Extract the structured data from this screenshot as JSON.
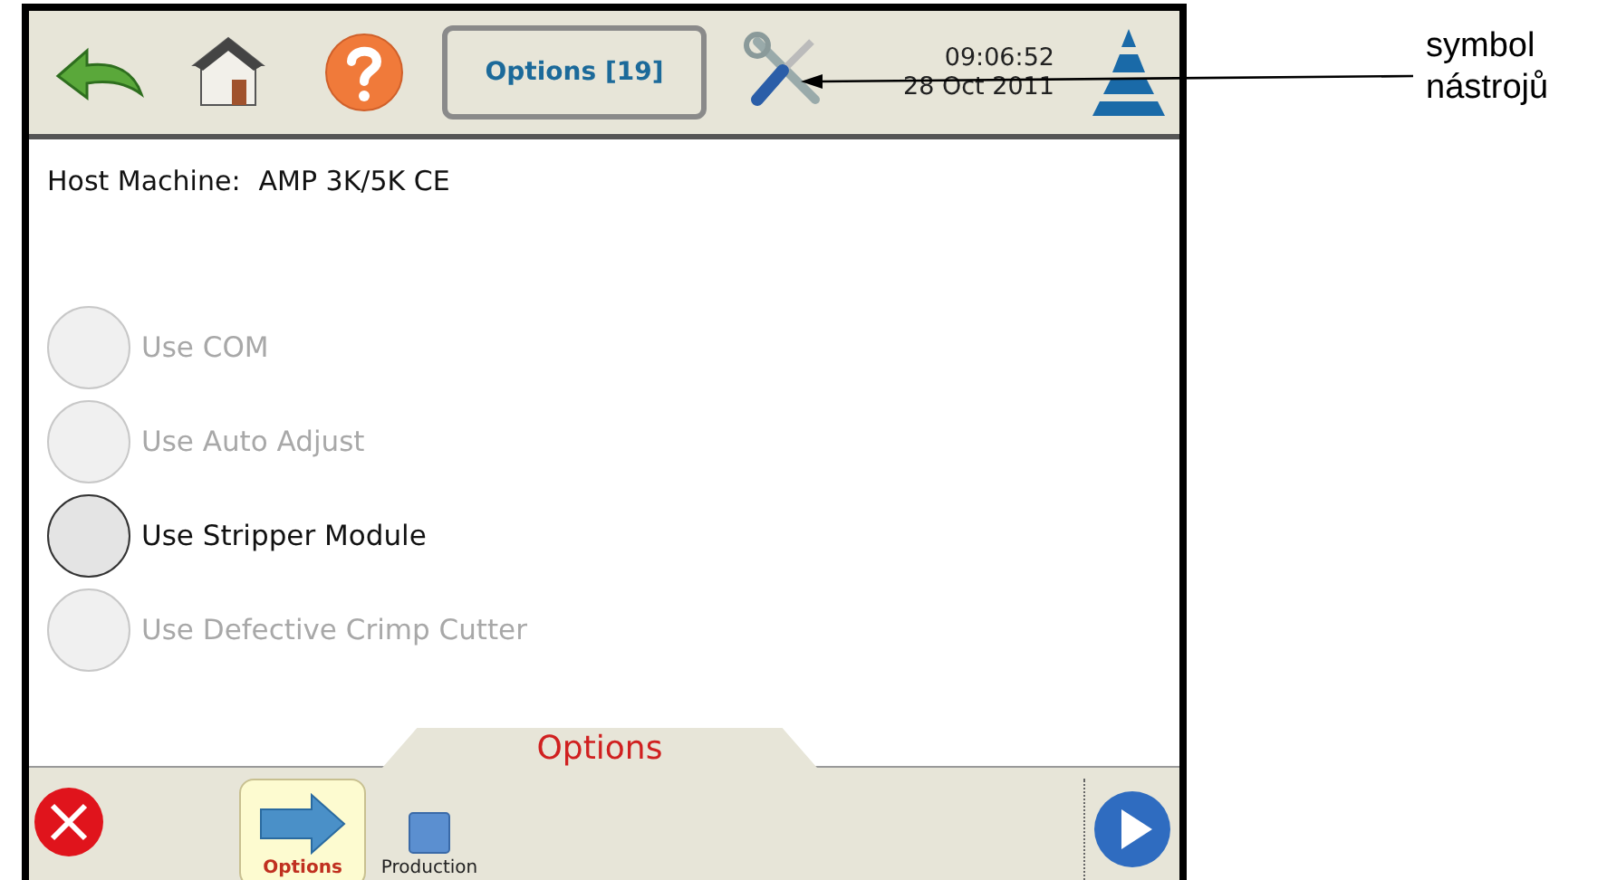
{
  "top_bar": {
    "title_button": "Options [19]",
    "time": "09:06:52",
    "date": "28 Oct 2011"
  },
  "host": {
    "label": "Host Machine:",
    "value": "AMP 3K/5K CE"
  },
  "options": [
    {
      "label": "Use COM",
      "disabled": true
    },
    {
      "label": "Use Auto Adjust",
      "disabled": true
    },
    {
      "label": "Use Stripper Module",
      "disabled": false
    },
    {
      "label": "Use Defective Crimp Cutter",
      "disabled": true
    }
  ],
  "tab_title": "Options",
  "nav_items": [
    {
      "label": "Options",
      "kind": "arrow",
      "selected": true
    },
    {
      "label": "Production",
      "kind": "square",
      "selected": false
    }
  ],
  "annotation": {
    "lines": [
      "symbol",
      "nástrojů"
    ]
  }
}
